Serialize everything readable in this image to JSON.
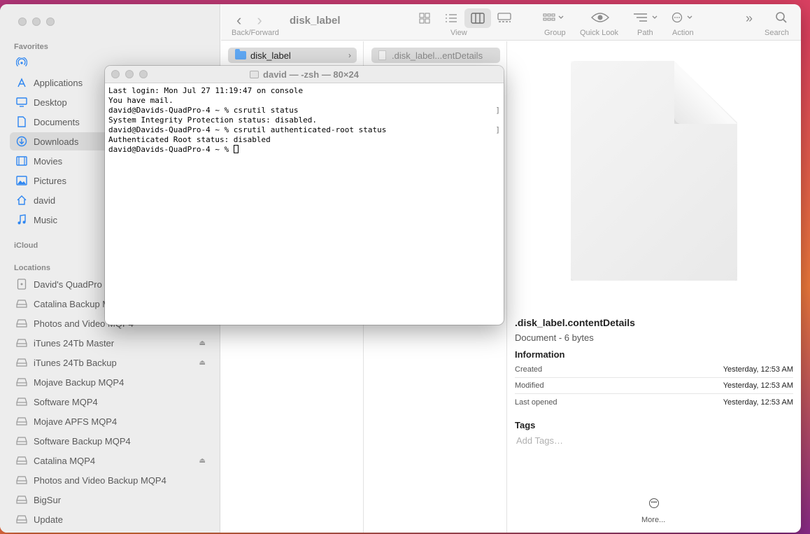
{
  "finder": {
    "title": "disk_label",
    "toolbar": {
      "back_forward_label": "Back/Forward",
      "view_label": "View",
      "group_label": "Group",
      "quick_look_label": "Quick Look",
      "path_label": "Path",
      "action_label": "Action",
      "search_label": "Search"
    },
    "sidebar": {
      "favorites_header": "Favorites",
      "favorites": [
        {
          "label": "",
          "icon": "airdrop-icon"
        },
        {
          "label": "Applications",
          "icon": "applications-icon"
        },
        {
          "label": "Desktop",
          "icon": "desktop-icon"
        },
        {
          "label": "Documents",
          "icon": "document-icon"
        },
        {
          "label": "Downloads",
          "icon": "download-icon",
          "selected": true
        },
        {
          "label": "Movies",
          "icon": "film-icon"
        },
        {
          "label": "Pictures",
          "icon": "photo-icon"
        },
        {
          "label": "david",
          "icon": "home-icon"
        },
        {
          "label": "Music",
          "icon": "music-icon"
        }
      ],
      "icloud_header": "iCloud",
      "locations_header": "Locations",
      "locations": [
        {
          "label": "David's QuadPro",
          "icon": "computer-icon"
        },
        {
          "label": "Catalina Backup M",
          "icon": "drive-icon"
        },
        {
          "label": "Photos and Video MQP4",
          "icon": "drive-icon"
        },
        {
          "label": "iTunes 24Tb Master",
          "icon": "drive-icon",
          "eject": true
        },
        {
          "label": "iTunes 24Tb Backup",
          "icon": "drive-icon",
          "eject": true
        },
        {
          "label": "Mojave Backup MQP4",
          "icon": "drive-icon"
        },
        {
          "label": "Software MQP4",
          "icon": "drive-icon"
        },
        {
          "label": "Mojave APFS MQP4",
          "icon": "drive-icon"
        },
        {
          "label": "Software Backup MQP4",
          "icon": "drive-icon"
        },
        {
          "label": "Catalina MQP4",
          "icon": "drive-icon",
          "eject": true
        },
        {
          "label": "Photos and Video Backup MQP4",
          "icon": "drive-icon"
        },
        {
          "label": "BigSur",
          "icon": "drive-icon"
        },
        {
          "label": "Update",
          "icon": "drive-icon"
        }
      ]
    },
    "columns": {
      "col1_item": "disk_label",
      "col2_item": ".disk_label...entDetails"
    },
    "preview": {
      "name": ".disk_label.contentDetails",
      "kind": "Document - 6 bytes",
      "info_header": "Information",
      "info": [
        {
          "key": "Created",
          "value": "Yesterday, 12:53 AM"
        },
        {
          "key": "Modified",
          "value": "Yesterday, 12:53 AM"
        },
        {
          "key": "Last opened",
          "value": "Yesterday, 12:53 AM"
        }
      ],
      "tags_header": "Tags",
      "tags_placeholder": "Add Tags…",
      "more_label": "More..."
    }
  },
  "terminal": {
    "title": "david — -zsh — 80×24",
    "lines": [
      "Last login: Mon Jul 27 11:19:47 on console",
      "You have mail.",
      "david@Davids-QuadPro-4 ~ % csrutil status",
      "System Integrity Protection status: disabled.",
      "david@Davids-QuadPro-4 ~ % csrutil authenticated-root status",
      "Authenticated Root status: disabled",
      "david@Davids-QuadPro-4 ~ % "
    ]
  }
}
